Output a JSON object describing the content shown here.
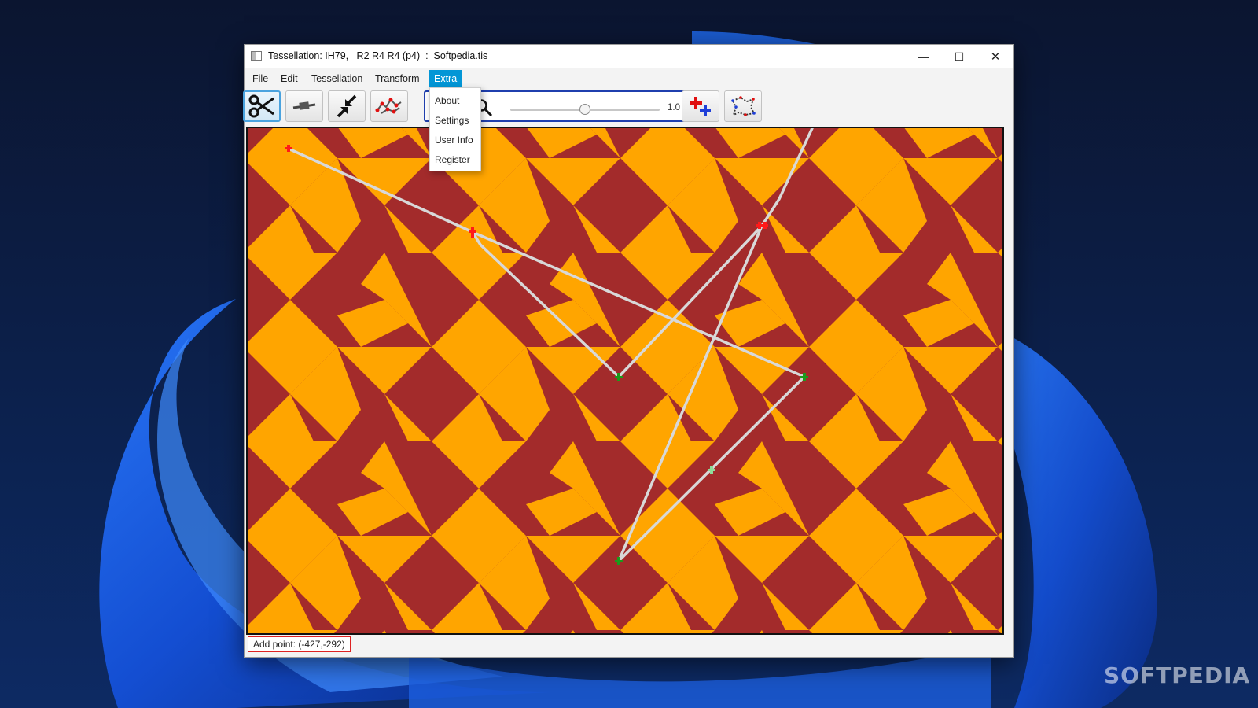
{
  "window": {
    "title": "Tessellation: IH79,   R2 R4 R4 (p4)  :  Softpedia.tis",
    "minimize_glyph": "—",
    "maximize_glyph": "☐",
    "close_glyph": "✕"
  },
  "menu": {
    "items": [
      "File",
      "Edit",
      "Tessellation",
      "Transform",
      "Extra"
    ],
    "active": "Extra"
  },
  "dropdown": {
    "items": [
      "About",
      "Settings",
      "User Info",
      "Register"
    ]
  },
  "toolbar": {
    "tools": [
      {
        "icon": "scissors-icon",
        "selected": true
      },
      {
        "icon": "erase-line-icon",
        "selected": false
      },
      {
        "icon": "shrink-arrows-icon",
        "selected": false
      },
      {
        "icon": "edit-polygon-icon",
        "selected": false
      }
    ],
    "zoom": {
      "icon": "magnifier-icon",
      "value_label": "1.0",
      "value": 0.5
    },
    "extra_tools": [
      {
        "icon": "add-points-icon"
      },
      {
        "icon": "tile-outline-icon"
      }
    ]
  },
  "colors": {
    "tile_a": "#a32b2b",
    "tile_b": "#ffa500",
    "edge": "#d8d8d8",
    "point_red": "#ff1a1a",
    "point_green": "#1b9b1b",
    "menu_active": "#0396d6",
    "zoom_border": "#1f3fae"
  },
  "status": {
    "text": "Add point: (-427,-292)"
  },
  "watermark": "SOFTPEDIA"
}
